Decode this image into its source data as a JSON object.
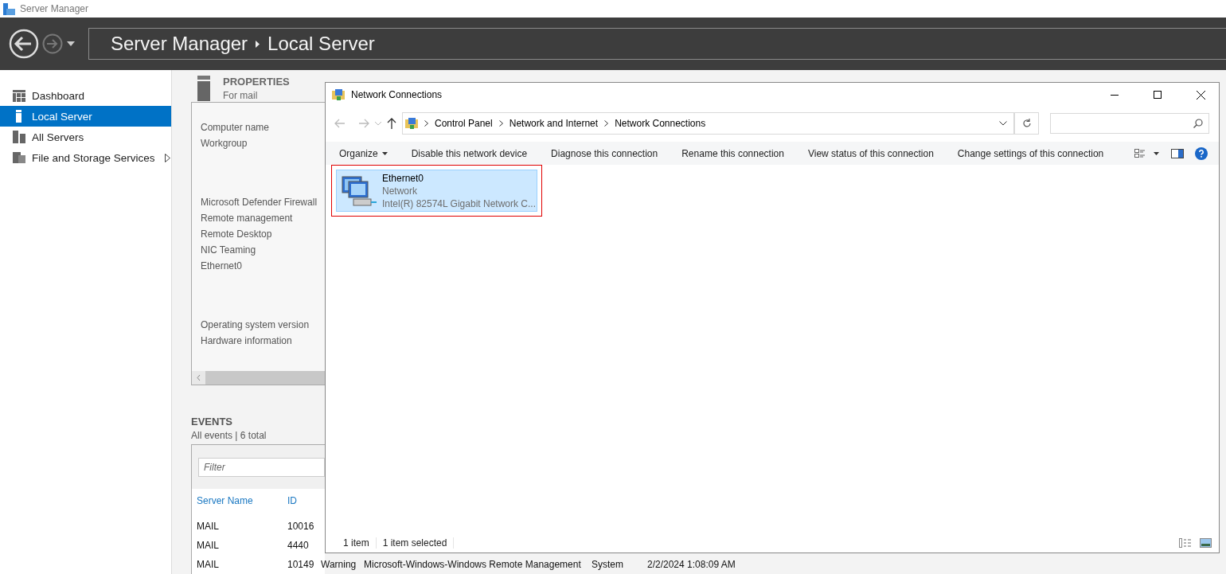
{
  "app": {
    "title": "Server Manager"
  },
  "header": {
    "breadcrumb": [
      "Server Manager",
      "Local Server"
    ]
  },
  "sidebar": {
    "items": [
      {
        "label": "Dashboard",
        "kind": "dashboard",
        "selected": false,
        "has_submenu": false
      },
      {
        "label": "Local Server",
        "kind": "server",
        "selected": true,
        "has_submenu": false
      },
      {
        "label": "All Servers",
        "kind": "servers",
        "selected": false,
        "has_submenu": false
      },
      {
        "label": "File and Storage Services",
        "kind": "storage",
        "selected": false,
        "has_submenu": true
      }
    ]
  },
  "properties": {
    "title": "PROPERTIES",
    "subtitle": "For mail",
    "groups": [
      [
        "Computer name",
        "Workgroup"
      ],
      [
        "Microsoft Defender Firewall",
        "Remote management",
        "Remote Desktop",
        "NIC Teaming",
        "Ethernet0"
      ],
      [
        "Operating system version",
        "Hardware information"
      ]
    ]
  },
  "events": {
    "title": "EVENTS",
    "subtitle": "All events | 6 total",
    "filter": {
      "placeholder": "Filter"
    },
    "columns": [
      "Server Name",
      "ID"
    ],
    "rows": [
      {
        "cells": [
          "MAIL",
          "10016"
        ]
      },
      {
        "cells": [
          "MAIL",
          "4440"
        ]
      },
      {
        "cells": [
          "MAIL",
          "10149",
          "Warning",
          "Microsoft-Windows-Windows Remote Management",
          "System",
          "2/2/2024 1:08:09 AM"
        ]
      }
    ]
  },
  "network_window": {
    "title": "Network Connections",
    "address": [
      "Control Panel",
      "Network and Internet",
      "Network Connections"
    ],
    "commands": [
      {
        "label": "Organize",
        "menu": true
      },
      {
        "label": "Disable this network device",
        "menu": false
      },
      {
        "label": "Diagnose this connection",
        "menu": false
      },
      {
        "label": "Rename this connection",
        "menu": false
      },
      {
        "label": "View status of this connection",
        "menu": false
      },
      {
        "label": "Change settings of this connection",
        "menu": false
      }
    ],
    "items": [
      {
        "name": "Ethernet0",
        "type": "Network",
        "adapter": "Intel(R) 82574L Gigabit Network C...",
        "selected": true,
        "outlined": true
      }
    ],
    "status": [
      "1 item",
      "1 item selected"
    ]
  }
}
